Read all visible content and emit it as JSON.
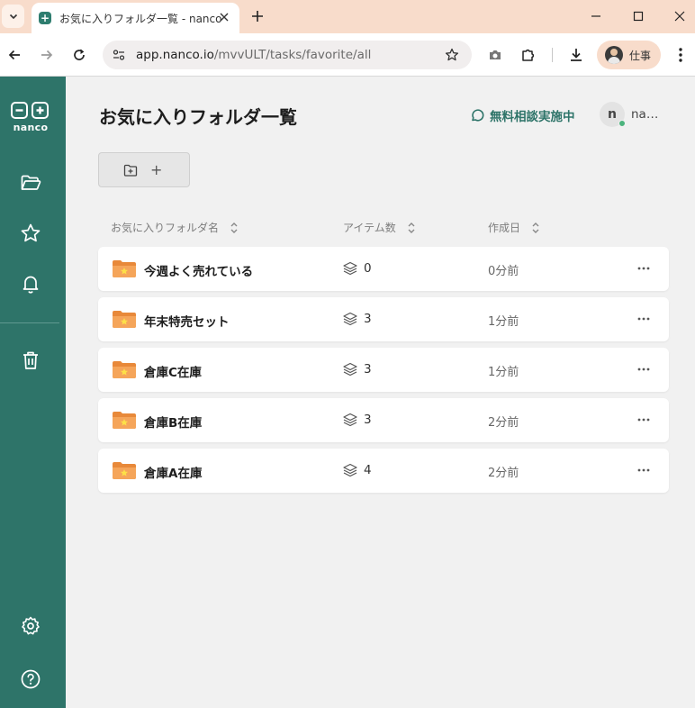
{
  "browser": {
    "tab_title": "お気に入りフォルダ一覧 - nanco",
    "favicon_symbol": "+",
    "url_host": "app.nanco.io",
    "url_path": "/mvvULT/tasks/favorite/all",
    "profile_name": "仕事"
  },
  "app": {
    "logo_text": "nanco",
    "logo_left_symbol": "−",
    "logo_right_symbol": "+",
    "accent_color": "#2e7469"
  },
  "sidebar": {
    "items": [
      {
        "icon": "folder-open-icon"
      },
      {
        "icon": "star-icon"
      },
      {
        "icon": "bell-icon"
      },
      {
        "icon": "trash-icon"
      },
      {
        "icon": "gear-icon"
      },
      {
        "icon": "help-circle-icon"
      }
    ]
  },
  "header": {
    "title": "お気に入りフォルダ一覧",
    "consult_label": "無料相談実施中",
    "user_initial": "n",
    "user_name": "na…"
  },
  "actions": {
    "new_folder_plus": "+"
  },
  "table": {
    "columns": [
      {
        "label": "お気に入りフォルダ名"
      },
      {
        "label": "アイテム数"
      },
      {
        "label": "作成日"
      }
    ],
    "rows": [
      {
        "name": "今週よく売れている",
        "count": "0",
        "created": "0分前"
      },
      {
        "name": "年末特売セット",
        "count": "3",
        "created": "1分前"
      },
      {
        "name": "倉庫C在庫",
        "count": "3",
        "created": "1分前"
      },
      {
        "name": "倉庫B在庫",
        "count": "3",
        "created": "2分前"
      },
      {
        "name": "倉庫A在庫",
        "count": "4",
        "created": "2分前"
      }
    ]
  }
}
